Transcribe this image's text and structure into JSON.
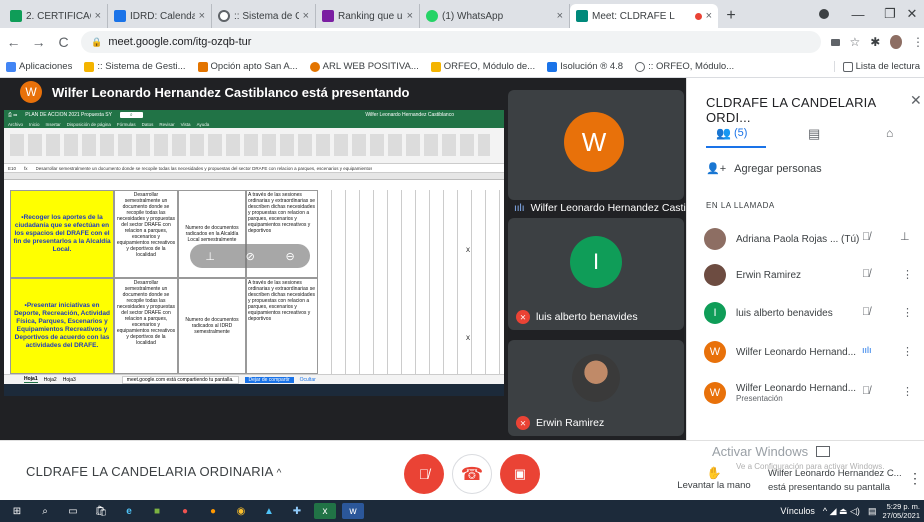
{
  "browser": {
    "tabs": [
      {
        "title": "2. CERTIFICACION_CU",
        "color": "#0f9d58"
      },
      {
        "title": "IDRD: Calendario - Se",
        "color": "#1a73e8"
      },
      {
        "title": ":: Sistema de Gestión",
        "color": "#5f6368"
      },
      {
        "title": "Ranking que ubica a C",
        "color": "#7b1fa2"
      },
      {
        "title": "(1) WhatsApp",
        "color": "#25d366"
      },
      {
        "title": "Meet: CLDRAFE L",
        "color": "#00897b"
      }
    ],
    "url": "meet.google.com/itg-ozqb-tur",
    "bookmarks": [
      {
        "label": "Aplicaciones",
        "color": "#4285f4"
      },
      {
        "label": ":: Sistema de Gesti...",
        "color": "#f4b400"
      },
      {
        "label": "Opción apto San A...",
        "color": "#e37400"
      },
      {
        "label": "ARL WEB POSITIVA...",
        "color": "#e37400"
      },
      {
        "label": "ORFEO, Módulo de...",
        "color": "#f4b400"
      },
      {
        "label": "Isolución ® 4.8",
        "color": "#1a73e8"
      },
      {
        "label": ":: ORFEO, Módulo...",
        "color": "#5f6368"
      }
    ],
    "reading_list": "Lista de lectura"
  },
  "meet": {
    "presenter_initial": "W",
    "presenting_text": "Wilfer Leonardo Hernandez Castiblanco está presentando",
    "tiles": [
      {
        "initial": "W",
        "name": "Wilfer Leonardo Hernandez Casti...",
        "color": "#e8710a",
        "speaking": true
      },
      {
        "initial": "I",
        "name": "luis alberto benavides",
        "color": "#0f9d58",
        "muted": true
      },
      {
        "initial": "",
        "name": "Erwin Ramirez",
        "color": "#5f6368",
        "muted": true
      }
    ],
    "meeting_name": "CLDRAFE LA CANDELARIA ORDINARIA",
    "raise_hand": "Levantar la mano",
    "presenting_sub_name": "Wilfer Leonardo Hernandez C...",
    "presenting_sub_text": "está presentando su pantalla",
    "activate_windows": "Activar Windows",
    "activate_sub": "Ve a Configuración para activar Windows."
  },
  "panel": {
    "title": "CLDRAFE LA CANDELARIA ORDI...",
    "people_count": "(5)",
    "add_people": "Agregar personas",
    "section": "EN LA LLAMADA",
    "participants": [
      {
        "name": "Adriana Paola Rojas ... (Tú)",
        "initial": "",
        "color": "#8d6e63"
      },
      {
        "name": "Erwin Ramirez",
        "initial": "",
        "color": "#6d4c41"
      },
      {
        "name": "luis alberto benavides",
        "initial": "I",
        "color": "#0f9d58"
      },
      {
        "name": "Wilfer Leonardo Hernand...",
        "initial": "W",
        "color": "#e8710a"
      },
      {
        "name": "Wilfer Leonardo Hernand...",
        "initial": "W",
        "color": "#e8710a",
        "sub": "Presentación"
      }
    ]
  },
  "spreadsheet": {
    "title": "PLAN DE ACCION 2021 Propuesta SY",
    "sheet_owner": "Wilfer Leonardo Hernandez Castiblanco",
    "menu": [
      "Archivo",
      "Inicio",
      "Insertar",
      "Disposición de página",
      "Fórmulas",
      "Datos",
      "Revisar",
      "Vista",
      "Ayuda"
    ],
    "cell_ref": "E10",
    "formula": "Desarrollar semestralmente un documento donde se recopile todas las necesidades y propuestas del sector DRAFE con relacion a parques, escenarios y equipamientos",
    "row1_yellow": "•Recoger los aportes de la ciudadanía que se efectúan en los espacios del DRAFE con el fin de presentarlos a la Alcaldía Local.",
    "row1_b": "Desarrollar semestralmente un documento donde se recopile todas las necesidades y propuestas del sector DRAFE con relacion a parques, escenarios y equipamientos recreativos y deportivos de la localidad",
    "row1_c": "Numero de documentos radicados en la Alcaldía Local semestralmente",
    "row1_d": "A través de las sesiones ordinarias y extraordinarias se describen dichas necesidades y propuestas con relacion a parques, escenarios y equipamientos recreativos y deportivos",
    "row2_yellow": "•Presentar iniciativas en Deporte, Recreación, Actividad Física, Parques, Escenarios y Equipamientos Recreativos y Deportivos de acuerdo con las actividades del DRAFE.",
    "row2_b": "Desarrollar semestralmente un documento donde se recopile todas las necesidades y propuestas del sector DRAFE con relacion a parques, escenarios y equipamientos recreativos y deportivos de la localidad",
    "row2_c": "Numero de documentos radicados al IDRD semestralmente",
    "row2_d": "A través de las sesiones ordinarias y extraordinarias se describen dichas necesidades y propuestas con relacion a parques, escenarios y equipamientos recreativos y deportivos",
    "x_mark": "X",
    "sheets": [
      "Hoja1",
      "Hoja2",
      "Hoja3"
    ],
    "share_notice": "meet.google.com está compartiendo tu pantalla.",
    "stop_share": "Dejar de compartir",
    "hide": "Ocultar"
  },
  "taskbar": {
    "lang": "Vínculos",
    "time": "5:29 p. m.",
    "date": "27/05/2021"
  },
  "colors": {
    "meet_bg": "#202124",
    "tile_bg": "#3c4043",
    "accent_blue": "#1a73e8",
    "mute_red": "#ea4335",
    "excel_green": "#217346"
  }
}
